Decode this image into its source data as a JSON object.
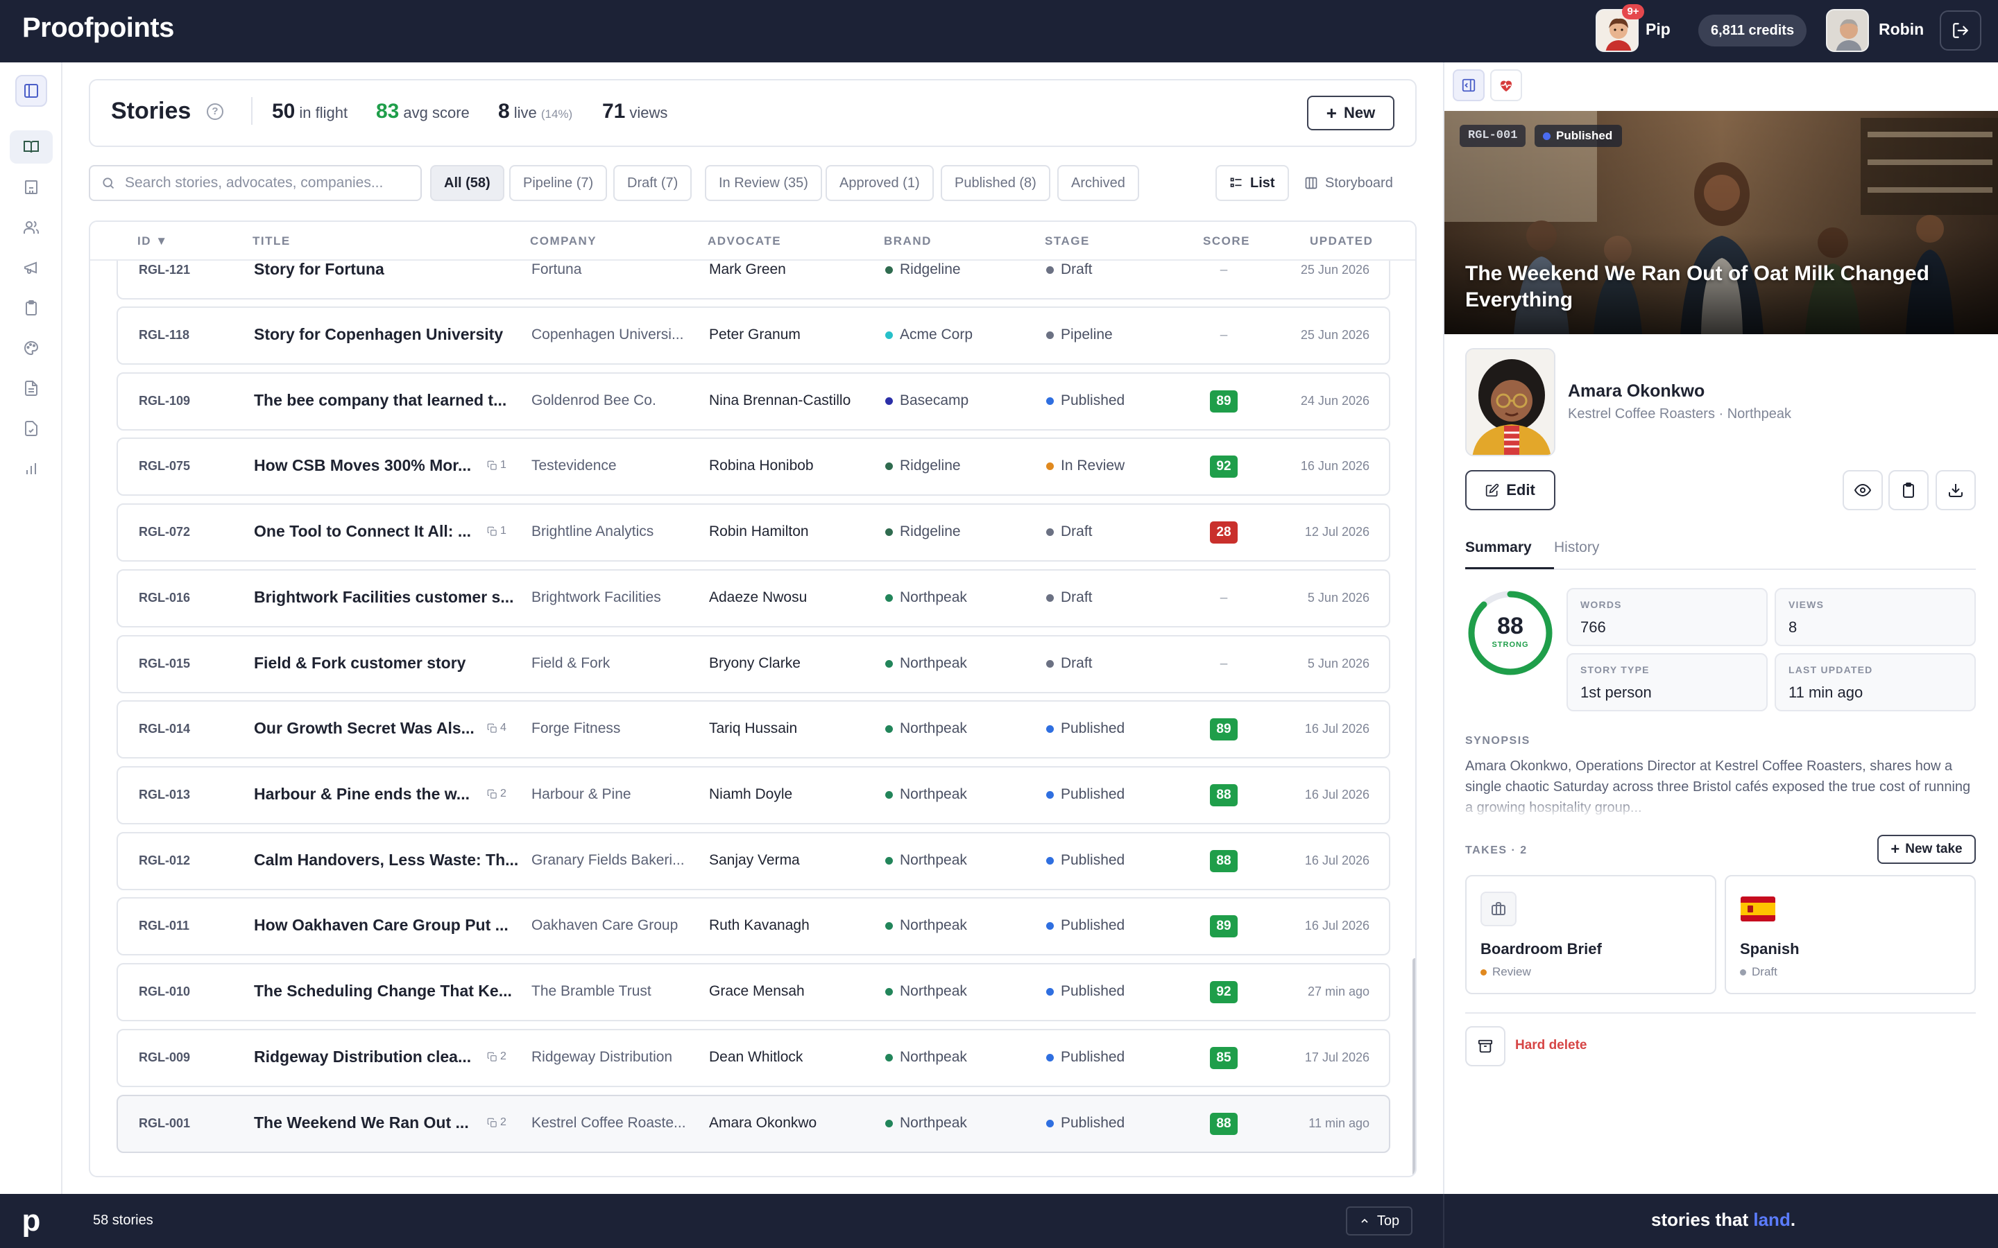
{
  "app": {
    "name": "Proofpoints",
    "footer_logo": "p"
  },
  "topbar": {
    "assistant": {
      "name": "Pip",
      "badge": "9+"
    },
    "credits": "6,811 credits",
    "user": {
      "name": "Robin"
    },
    "icons": {
      "logout": "logout-icon"
    }
  },
  "rail": {
    "items": [
      {
        "name": "stories-icon",
        "active": true
      },
      {
        "name": "companies-icon",
        "active": false
      },
      {
        "name": "advocates-icon",
        "active": false
      },
      {
        "name": "campaigns-icon",
        "active": false
      },
      {
        "name": "clipboard-icon",
        "active": false
      },
      {
        "name": "brand-palette-icon",
        "active": false
      },
      {
        "name": "documents-icon",
        "active": false
      },
      {
        "name": "approvals-icon",
        "active": false
      },
      {
        "name": "analytics-icon",
        "active": false
      }
    ]
  },
  "header": {
    "title": "Stories",
    "stats": {
      "in_flight_value": "50",
      "in_flight_label": "in flight",
      "avg_score_value": "83",
      "avg_score_label": "avg score",
      "live_value": "8",
      "live_label": "live",
      "live_pct": "(14%)",
      "views_value": "71",
      "views_label": "views"
    },
    "new_label": "New"
  },
  "search": {
    "placeholder": "Search stories, advocates, companies..."
  },
  "filters": [
    {
      "label": "All (58)",
      "active": true
    },
    {
      "label": "Pipeline (7)",
      "active": false
    },
    {
      "label": "Draft (7)",
      "active": false
    },
    {
      "label": "In Review (35)",
      "active": false
    },
    {
      "label": "Approved (1)",
      "active": false
    },
    {
      "label": "Published (8)",
      "active": false
    },
    {
      "label": "Archived",
      "active": false
    }
  ],
  "views": {
    "list": "List",
    "storyboard": "Storyboard"
  },
  "table": {
    "headers": {
      "id": "ID ▼",
      "title": "TITLE",
      "company": "COMPANY",
      "advocate": "ADVOCATE",
      "brand": "BRAND",
      "stage": "STAGE",
      "score": "SCORE",
      "updated": "UPDATED"
    },
    "rows": [
      {
        "id": "RGL-121",
        "title": "Story for Fortuna",
        "takes": "",
        "company": "Fortuna",
        "advocate": "Mark Green",
        "brand": "Ridgeline",
        "brand_color": "#2f6b4f",
        "stage": "Draft",
        "stage_color": "#6b7183",
        "score": "–",
        "score_color": "",
        "updated": "25 Jun 2026"
      },
      {
        "id": "RGL-118",
        "title": "Story for Copenhagen University",
        "takes": "",
        "company": "Copenhagen Universi...",
        "advocate": "Peter Granum",
        "brand": "Acme Corp",
        "brand_color": "#27c0c9",
        "stage": "Pipeline",
        "stage_color": "#6b7183",
        "score": "–",
        "score_color": "",
        "updated": "25 Jun 2026"
      },
      {
        "id": "RGL-109",
        "title": "The bee company that learned t...",
        "takes": "",
        "company": "Goldenrod Bee Co.",
        "advocate": "Nina Brennan-Castillo",
        "brand": "Basecamp",
        "brand_color": "#2b2fa8",
        "stage": "Published",
        "stage_color": "#2f6fe0",
        "score": "89",
        "score_color": "#1f9e4a",
        "updated": "24 Jun 2026"
      },
      {
        "id": "RGL-075",
        "title": "How CSB Moves 300% Mor...",
        "takes": "1",
        "company": "Testevidence",
        "advocate": "Robina Honibob",
        "brand": "Ridgeline",
        "brand_color": "#2f6b4f",
        "stage": "In Review",
        "stage_color": "#e0891f",
        "score": "92",
        "score_color": "#1f9e4a",
        "updated": "16 Jun 2026"
      },
      {
        "id": "RGL-072",
        "title": "One Tool to Connect It All: ...",
        "takes": "1",
        "company": "Brightline Analytics",
        "advocate": "Robin Hamilton",
        "brand": "Ridgeline",
        "brand_color": "#2f6b4f",
        "stage": "Draft",
        "stage_color": "#6b7183",
        "score": "28",
        "score_color": "#c9302c",
        "updated": "12 Jul 2026"
      },
      {
        "id": "RGL-016",
        "title": "Brightwork Facilities customer s...",
        "takes": "",
        "company": "Brightwork Facilities",
        "advocate": "Adaeze Nwosu",
        "brand": "Northpeak",
        "brand_color": "#22855a",
        "stage": "Draft",
        "stage_color": "#6b7183",
        "score": "–",
        "score_color": "",
        "updated": "5 Jun 2026"
      },
      {
        "id": "RGL-015",
        "title": "Field & Fork customer story",
        "takes": "",
        "company": "Field & Fork",
        "advocate": "Bryony Clarke",
        "brand": "Northpeak",
        "brand_color": "#22855a",
        "stage": "Draft",
        "stage_color": "#6b7183",
        "score": "–",
        "score_color": "",
        "updated": "5 Jun 2026"
      },
      {
        "id": "RGL-014",
        "title": "Our Growth Secret Was Als...",
        "takes": "4",
        "company": "Forge Fitness",
        "advocate": "Tariq Hussain",
        "brand": "Northpeak",
        "brand_color": "#22855a",
        "stage": "Published",
        "stage_color": "#2f6fe0",
        "score": "89",
        "score_color": "#1f9e4a",
        "updated": "16 Jul 2026"
      },
      {
        "id": "RGL-013",
        "title": "Harbour & Pine ends the w...",
        "takes": "2",
        "company": "Harbour & Pine",
        "advocate": "Niamh Doyle",
        "brand": "Northpeak",
        "brand_color": "#22855a",
        "stage": "Published",
        "stage_color": "#2f6fe0",
        "score": "88",
        "score_color": "#1f9e4a",
        "updated": "16 Jul 2026"
      },
      {
        "id": "RGL-012",
        "title": "Calm Handovers, Less Waste: Th...",
        "takes": "",
        "company": "Granary Fields Bakeri...",
        "advocate": "Sanjay Verma",
        "brand": "Northpeak",
        "brand_color": "#22855a",
        "stage": "Published",
        "stage_color": "#2f6fe0",
        "score": "88",
        "score_color": "#1f9e4a",
        "updated": "16 Jul 2026"
      },
      {
        "id": "RGL-011",
        "title": "How Oakhaven Care Group Put ...",
        "takes": "",
        "company": "Oakhaven Care Group",
        "advocate": "Ruth Kavanagh",
        "brand": "Northpeak",
        "brand_color": "#22855a",
        "stage": "Published",
        "stage_color": "#2f6fe0",
        "score": "89",
        "score_color": "#1f9e4a",
        "updated": "16 Jul 2026"
      },
      {
        "id": "RGL-010",
        "title": "The Scheduling Change That Ke...",
        "takes": "",
        "company": "The Bramble Trust",
        "advocate": "Grace Mensah",
        "brand": "Northpeak",
        "brand_color": "#22855a",
        "stage": "Published",
        "stage_color": "#2f6fe0",
        "score": "92",
        "score_color": "#1f9e4a",
        "updated": "27 min ago"
      },
      {
        "id": "RGL-009",
        "title": "Ridgeway Distribution clea...",
        "takes": "2",
        "company": "Ridgeway Distribution",
        "advocate": "Dean Whitlock",
        "brand": "Northpeak",
        "brand_color": "#22855a",
        "stage": "Published",
        "stage_color": "#2f6fe0",
        "score": "85",
        "score_color": "#1f9e4a",
        "updated": "17 Jul 2026"
      },
      {
        "id": "RGL-001",
        "title": "The Weekend We Ran Out ...",
        "takes": "2",
        "company": "Kestrel Coffee Roaste...",
        "advocate": "Amara Okonkwo",
        "brand": "Northpeak",
        "brand_color": "#22855a",
        "stage": "Published",
        "stage_color": "#2f6fe0",
        "score": "88",
        "score_color": "#1f9e4a",
        "updated": "11 min ago",
        "selected": true
      }
    ]
  },
  "footer": {
    "count": "58 stories",
    "top_label": "Top",
    "tagline_main": "stories that ",
    "tagline_hl": "land",
    "tagline_end": "."
  },
  "detail": {
    "id": "RGL-001",
    "status": "Published",
    "title": "The Weekend We Ran Out of Oat Milk Changed Everything",
    "advocate_name": "Amara Okonkwo",
    "advocate_sub": "Kestrel Coffee Roasters · Northpeak",
    "edit_label": "Edit",
    "tabs": {
      "summary": "Summary",
      "history": "History"
    },
    "score": {
      "value": "88",
      "label": "STRONG",
      "fraction": 0.88
    },
    "stats": {
      "words_label": "WORDS",
      "words": "766",
      "views_label": "VIEWS",
      "views": "8",
      "type_label": "STORY TYPE",
      "type": "1st person",
      "updated_label": "LAST UPDATED",
      "updated": "11 min ago"
    },
    "synopsis_label": "SYNOPSIS",
    "synopsis": "Amara Okonkwo, Operations Director at Kestrel Coffee Roasters, shares how a single chaotic Saturday across three Bristol cafés exposed the true cost of running a growing hospitality group...",
    "takes_label": "TAKES · 2",
    "new_take_label": "New take",
    "takes": [
      {
        "name": "Boardroom Brief",
        "status": "Review",
        "status_color": "#e0891f",
        "icon": "briefcase-icon"
      },
      {
        "name": "Spanish",
        "status": "Draft",
        "status_color": "#9aa0ae",
        "icon": "spain-flag-icon"
      }
    ],
    "hard_delete_label": "Hard delete"
  }
}
